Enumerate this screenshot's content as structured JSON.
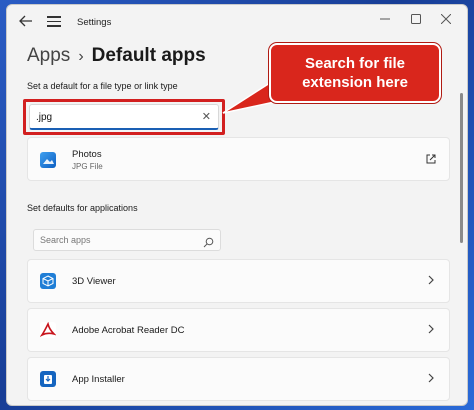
{
  "titlebar": {
    "title": "Settings",
    "back_icon": "back-arrow-icon",
    "menu_icon": "hamburger-menu-icon",
    "min_icon": "minimize-icon",
    "max_icon": "maximize-icon",
    "close_icon": "close-icon"
  },
  "breadcrumb": {
    "parent": "Apps",
    "separator": "›",
    "current": "Default apps"
  },
  "filetype_section": {
    "label": "Set a default for a file type or link type",
    "search_value": ".jpg",
    "result": {
      "name": "Photos",
      "subtitle": "JPG File",
      "icon": "photos-icon",
      "action_icon": "open-external-icon"
    }
  },
  "annotation": {
    "text_line1": "Search for file",
    "text_line2": "extension here",
    "color": "#d9261c"
  },
  "apps_section": {
    "label": "Set defaults for applications",
    "search_placeholder": "Search apps",
    "items": [
      {
        "name": "3D Viewer",
        "icon": "3d-viewer-icon"
      },
      {
        "name": "Adobe Acrobat Reader DC",
        "icon": "acrobat-icon"
      },
      {
        "name": "App Installer",
        "icon": "app-installer-icon"
      }
    ]
  },
  "colors": {
    "accent": "#1a5fb4",
    "highlight_border": "#d21f1f",
    "window_bg": "#f3f3f3"
  }
}
